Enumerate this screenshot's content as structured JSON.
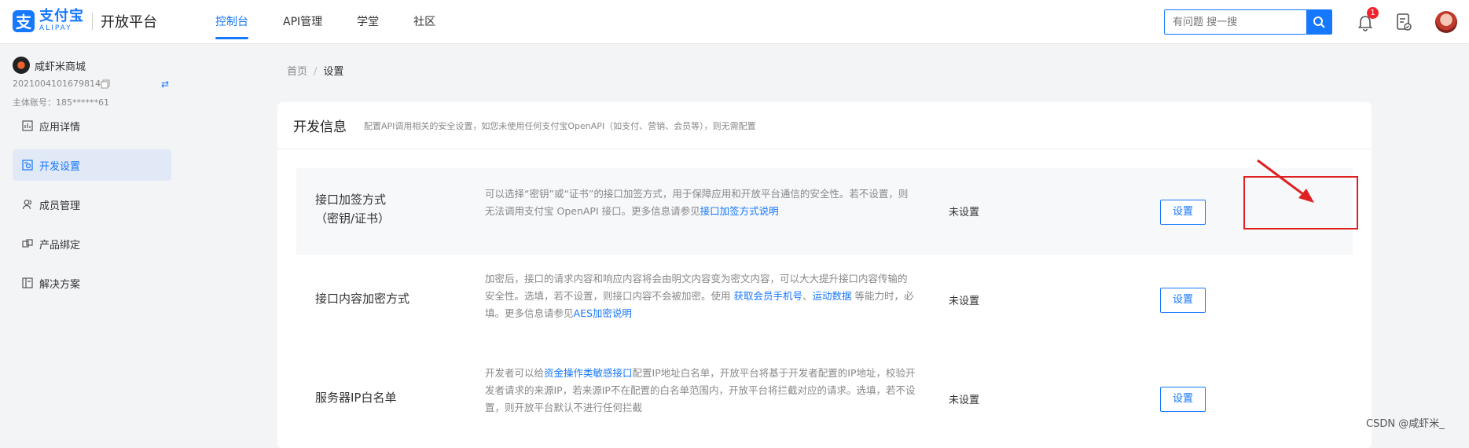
{
  "header": {
    "logo_cn": "支付宝",
    "logo_en": "ALIPAY",
    "logo_glyph": "支",
    "platform": "开放平台",
    "nav": [
      "控制台",
      "API管理",
      "学堂",
      "社区"
    ],
    "search_placeholder": "有问题 搜一搜",
    "notification_count": "1"
  },
  "sidebar": {
    "app_name": "咸虾米商城",
    "app_id": "2021004101679814",
    "main_account": "主体账号：185******61",
    "items": [
      "应用详情",
      "开发设置",
      "成员管理",
      "产品绑定",
      "解决方案"
    ]
  },
  "breadcrumb": {
    "home": "首页",
    "sep": "/",
    "current": "设置"
  },
  "card": {
    "title": "开发信息",
    "desc": "配置API调用相关的安全设置，如您未使用任何支付宝OpenAPI（如支付、营销、会员等），则无需配置"
  },
  "rows": [
    {
      "label_line1": "接口加签方式",
      "label_line2": "（密钥/证书）",
      "desc_a": "可以选择“密钥”或“证书”的接口加签方式，用于保障应用和开放平台通信的安全性。若不设置，则无法调用支付宝 OpenAPI 接口。更多信息请参见",
      "desc_link1": "接口加签方式说明",
      "status": "未设置",
      "button": "设置"
    },
    {
      "label": "接口内容加密方式",
      "desc_a": "加密后，接口的请求内容和响应内容将会由明文内容变为密文内容，可以大大提升接口内容传输的安全性。选填，若不设置，则接口内容不会被加密。使用 ",
      "desc_link1": "获取会员手机号",
      "desc_b": "、",
      "desc_link2": "运动数据",
      "desc_c": " 等能力时，必填。更多信息请参见",
      "desc_link3": "AES加密说明",
      "status": "未设置",
      "button": "设置"
    },
    {
      "label": "服务器IP白名单",
      "desc_a": "开发者可以给",
      "desc_link1": "资金操作类敏感接口",
      "desc_b": "配置IP地址白名单，开放平台将基于开发者配置的IP地址，校验开发者请求的来源IP，若来源IP不在配置的白名单范围内，开放平台将拦截对应的请求。选填，若不设置，则开放平台默认不进行任何拦截",
      "status": "未设置",
      "button": "设置"
    }
  ],
  "watermark": "CSDN @咸虾米_",
  "colors": {
    "brand": "#1677ff",
    "highlight": "#e02020"
  }
}
